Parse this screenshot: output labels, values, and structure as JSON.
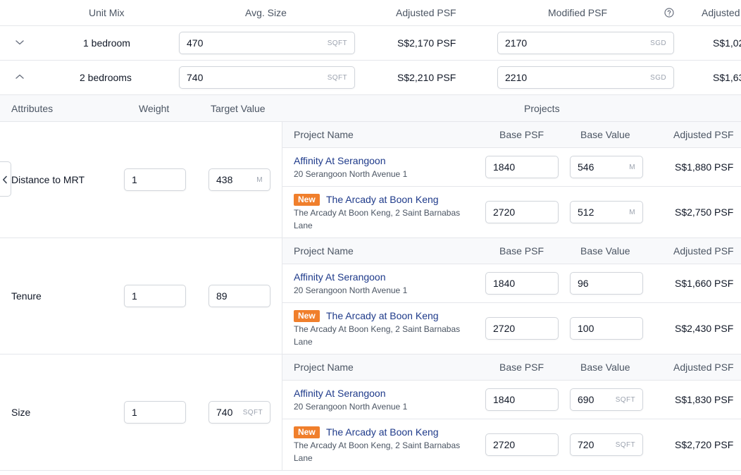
{
  "unit_header": {
    "unit_mix": "Unit Mix",
    "avg_size": "Avg. Size",
    "adjusted_psf": "Adjusted PSF",
    "modified_psf": "Modified PSF",
    "adjusted_value": "Adjusted"
  },
  "unit_rows": [
    {
      "label": "1 bedroom",
      "avg_size": "470",
      "size_unit": "SQFT",
      "adjusted_psf": "S$2,170 PSF",
      "modified_psf": "2170",
      "currency": "SGD",
      "adjusted_value": "S$1,02"
    },
    {
      "label": "2 bedrooms",
      "avg_size": "740",
      "size_unit": "SQFT",
      "adjusted_psf": "S$2,210 PSF",
      "modified_psf": "2210",
      "currency": "SGD",
      "adjusted_value": "S$1,63"
    }
  ],
  "attr_header": {
    "attributes": "Attributes",
    "weight": "Weight",
    "target_value": "Target Value",
    "projects": "Projects"
  },
  "project_header": {
    "name": "Project Name",
    "base_psf": "Base PSF",
    "base_value": "Base Value",
    "adjusted_psf": "Adjusted PSF"
  },
  "new_badge": "New",
  "attributes": [
    {
      "label": "Distance to MRT",
      "weight": "1",
      "target": "438",
      "target_unit": "M",
      "projects": [
        {
          "name": "Affinity At Serangoon",
          "address": "20 Serangoon North Avenue 1",
          "base_psf": "1840",
          "base_value": "546",
          "value_unit": "M",
          "adjusted_psf": "S$1,880 PSF"
        },
        {
          "name": "The Arcady at Boon Keng",
          "address": "The Arcady At Boon Keng, 2 Saint Barnabas Lane",
          "base_psf": "2720",
          "base_value": "512",
          "value_unit": "M",
          "adjusted_psf": "S$2,750 PSF"
        }
      ]
    },
    {
      "label": "Tenure",
      "weight": "1",
      "target": "89",
      "target_unit": "",
      "projects": [
        {
          "name": "Affinity At Serangoon",
          "address": "20 Serangoon North Avenue 1",
          "base_psf": "1840",
          "base_value": "96",
          "value_unit": "",
          "adjusted_psf": "S$1,660 PSF"
        },
        {
          "name": "The Arcady at Boon Keng",
          "address": "The Arcady At Boon Keng, 2 Saint Barnabas Lane",
          "base_psf": "2720",
          "base_value": "100",
          "value_unit": "",
          "adjusted_psf": "S$2,430 PSF"
        }
      ]
    },
    {
      "label": "Size",
      "weight": "1",
      "target": "740",
      "target_unit": "SQFT",
      "projects": [
        {
          "name": "Affinity At Serangoon",
          "address": "20 Serangoon North Avenue 1",
          "base_psf": "1840",
          "base_value": "690",
          "value_unit": "SQFT",
          "adjusted_psf": "S$1,830 PSF"
        },
        {
          "name": "The Arcady at Boon Keng",
          "address": "The Arcady At Boon Keng, 2 Saint Barnabas Lane",
          "base_psf": "2720",
          "base_value": "720",
          "value_unit": "SQFT",
          "adjusted_psf": "S$2,720 PSF"
        }
      ]
    }
  ],
  "colors": {
    "badge": "#f07f2c",
    "link": "#1e3a8a",
    "band": "#f8f9fb"
  }
}
